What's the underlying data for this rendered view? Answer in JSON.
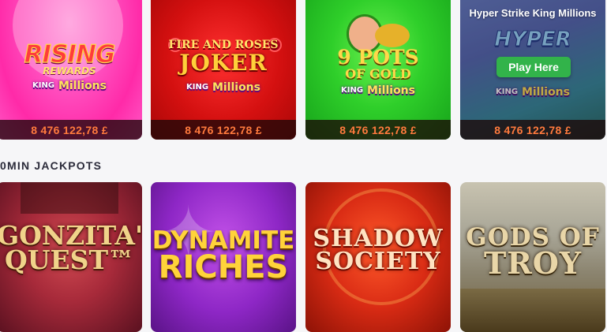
{
  "row1": {
    "tiles": [
      {
        "game": "rising-rewards",
        "logo_main": "RISING",
        "logo_sub": "REWARDS",
        "king_prefix": "KING",
        "king_word": "Millions",
        "jackpot": "8 476 122,78 £"
      },
      {
        "game": "fire-and-roses-joker",
        "logo_top": "FIRE AND ROSES",
        "logo_main": "JOKER",
        "king_prefix": "KING",
        "king_word": "Millions",
        "jackpot": "8 476 122,78 £"
      },
      {
        "game": "9-pots-of-gold",
        "logo_main": "9 POTS",
        "logo_sub": "OF GOLD",
        "king_prefix": "KING",
        "king_word": "Millions",
        "jackpot": "8 476 122,78 £"
      },
      {
        "game": "hyper-strike",
        "hover_title": "Hyper Strike King Millions",
        "logo_main": "HYPER",
        "play_label": "Play Here",
        "king_prefix": "KING",
        "king_word": "Millions",
        "jackpot": "8 476 122,78 £"
      }
    ]
  },
  "section": {
    "title": "0MIN JACKPOTS"
  },
  "row2": {
    "tiles": [
      {
        "game": "gonzitas-quest",
        "line1": "GONZITA'S",
        "line2": "QUEST™"
      },
      {
        "game": "dynamite-riches",
        "line1": "DYNAMITE",
        "line2": "RICHES"
      },
      {
        "game": "shadow-society",
        "line1": "SHADOW",
        "line2": "SOCIETY"
      },
      {
        "game": "gods-of-troy",
        "line1": "GODS OF",
        "line2": "TROY"
      }
    ]
  },
  "colors": {
    "jackpot_text": "#ff7a3d",
    "play_button": "#32b34a",
    "page_bg": "#f6f6f8",
    "section_title": "#2b2b3a"
  }
}
